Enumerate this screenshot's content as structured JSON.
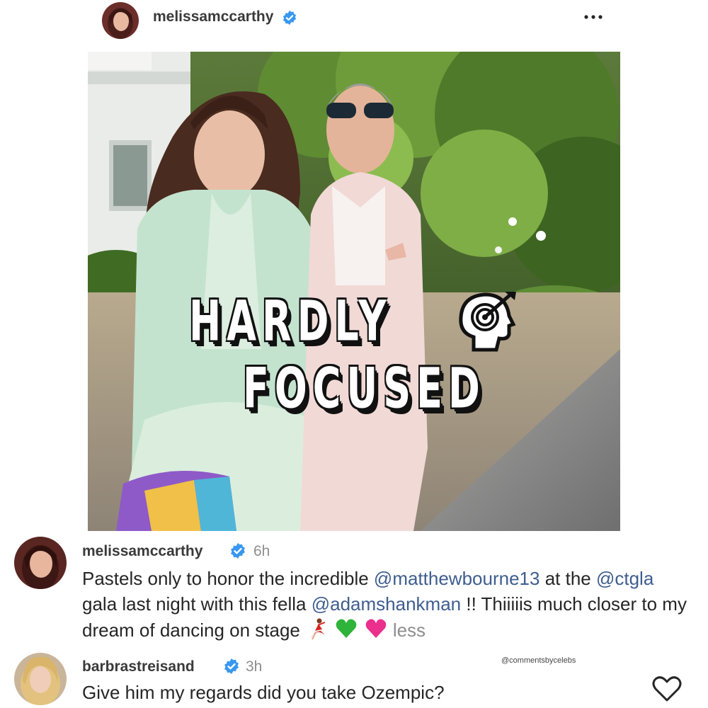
{
  "post": {
    "author": "melissamccarthy",
    "more_icon": "more-horizontal-icon",
    "verified_icon": "verified-badge-icon"
  },
  "watermark": {
    "line1": "HARDLY",
    "line2": "FOCUSED",
    "icon": "head-target-icon"
  },
  "comments": [
    {
      "username": "melissamccarthy",
      "time": "6h",
      "text_parts": [
        {
          "text": "Pastels only to honor the incredible "
        },
        {
          "text": "@matthewbourne13",
          "mention": true
        },
        {
          "text": " at the "
        },
        {
          "text": "@ctgla",
          "mention": true
        },
        {
          "text": " gala last night with this fella "
        },
        {
          "text": "@adamshankman",
          "mention": true
        },
        {
          "text": " !! Thiiiiis much closer to my dream of dancing on stage "
        }
      ],
      "emojis": [
        "dancer-emoji",
        "green-heart-emoji",
        "pink-heart-emoji"
      ],
      "less_label": "less"
    },
    {
      "username": "barbrastreisand",
      "time": "3h",
      "text": "Give him my regards did you take Ozempic?",
      "like_icon": "heart-outline-icon"
    }
  ],
  "credit": "@commentsbycelebs",
  "colors": {
    "mention": "#3e5d8f",
    "verified": "#3897f0",
    "muted": "#8e8e8e"
  }
}
